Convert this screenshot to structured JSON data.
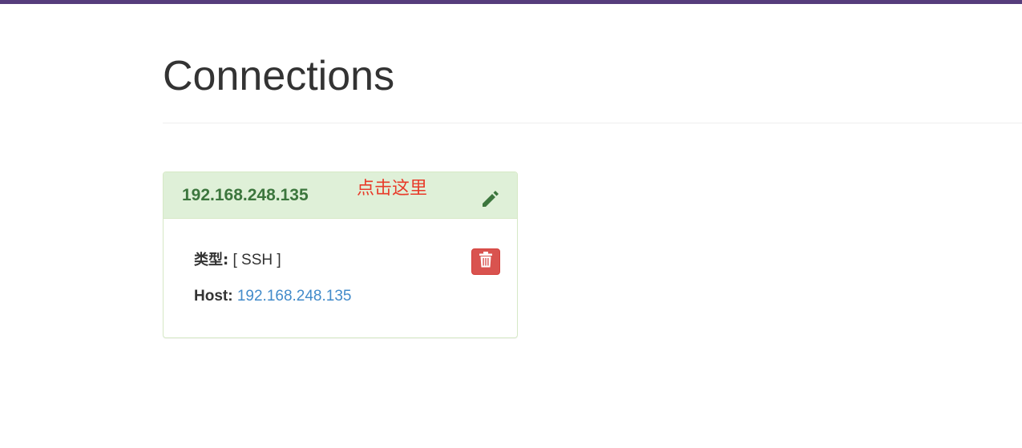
{
  "header": {
    "accent_color": "#563d7c"
  },
  "page": {
    "title": "Connections"
  },
  "connection_card": {
    "title": "192.168.248.135",
    "annotation": "点击这里",
    "edit_icon": "pencil-icon",
    "delete_icon": "trash-icon",
    "type_label": "类型:",
    "type_value": "[ SSH ]",
    "host_label": "Host:",
    "host_value": "192.168.248.135",
    "colors": {
      "heading_bg": "#dff0d8",
      "heading_text": "#3c763d",
      "annotation": "#e83b2a",
      "delete_bg": "#d9534f",
      "link": "#428bca"
    }
  }
}
